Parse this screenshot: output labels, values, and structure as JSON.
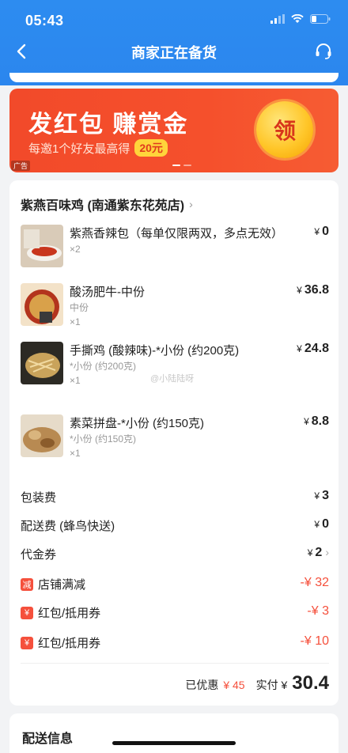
{
  "status": {
    "time": "05:43"
  },
  "nav": {
    "title": "商家正在备货"
  },
  "banner": {
    "title": "发红包 赚赏金",
    "subtitle": "每邀1个好友最高得",
    "badge": "20元",
    "coin_label": "领",
    "ad_tag": "广告"
  },
  "shop": {
    "name": "紫燕百味鸡 (南通紫东花苑店)"
  },
  "items": [
    {
      "name": "紫燕香辣包（每单仅限两双，多点无效）",
      "spec": "",
      "qty": "×2",
      "price": "0"
    },
    {
      "name": "酸汤肥牛-中份",
      "spec": "中份",
      "qty": "×1",
      "price": "36.8"
    },
    {
      "name": "手撕鸡 (酸辣味)-*小份 (约200克)",
      "spec": "*小份 (约200克)",
      "qty": "×1",
      "price": "24.8"
    },
    {
      "name": "素菜拼盘-*小份 (约150克)",
      "spec": "*小份 (约150克)",
      "qty": "×1",
      "price": "8.8"
    }
  ],
  "currency": "¥",
  "watermark": "@小陆陆呀",
  "fees": [
    {
      "label": "包装费",
      "value": "3"
    },
    {
      "label": "配送费 (蜂鸟快送)",
      "value": "0"
    },
    {
      "label": "代金券",
      "value": "2"
    },
    {
      "label": "店铺满减",
      "value": "-¥ 32",
      "icon": "减"
    },
    {
      "label": "红包/抵用券",
      "value": "-¥ 3",
      "icon": "¥"
    },
    {
      "label": "红包/抵用券",
      "value": "-¥ 10",
      "icon": "¥"
    }
  ],
  "total": {
    "discount_label": "已优惠",
    "discount_value": "¥ 45",
    "paid_label": "实付 ¥",
    "paid_value": "30.4"
  },
  "delivery": {
    "title": "配送信息"
  },
  "colors": {
    "header": "#2d8cf0",
    "accent_red": "#f5503c",
    "banner": "#f24a2a"
  }
}
